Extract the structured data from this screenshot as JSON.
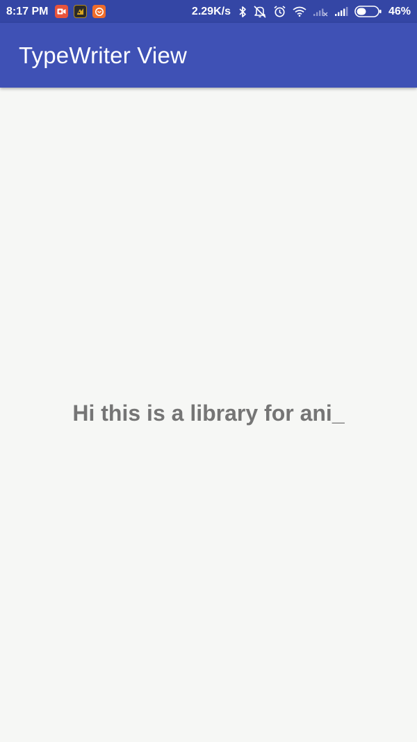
{
  "status_bar": {
    "time": "8:17 PM",
    "network_speed": "2.29K/s",
    "battery_percent": "46%",
    "battery_level": 0.46,
    "icons": [
      "screen-recorder-icon",
      "game-icon",
      "app-notification-icon",
      "bluetooth-icon",
      "do-not-disturb-icon",
      "alarm-icon",
      "wifi-icon",
      "signal-no-sim-icon",
      "signal-icon",
      "battery-icon"
    ],
    "background_color": "#3446a5"
  },
  "app_bar": {
    "title": "TypeWriter View",
    "background_color": "#3f51b5"
  },
  "main": {
    "typewriter_text": "Hi this is a library for ani_",
    "text_color": "#757575",
    "background_color": "#f6f7f5"
  }
}
